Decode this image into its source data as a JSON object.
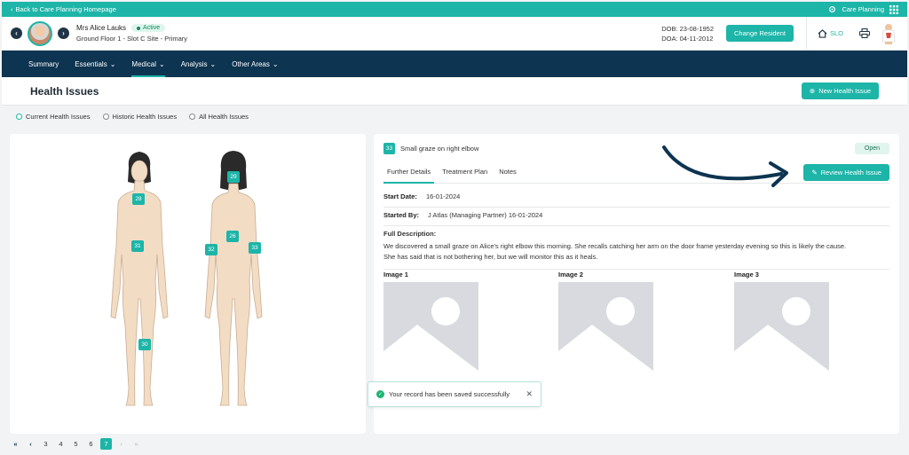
{
  "topbar": {
    "back_label": "Back to Care Planning Homepage",
    "app_label": "Care Planning"
  },
  "resident": {
    "name": "Mrs Alice Lauks",
    "status": "Active",
    "location": "Ground Floor 1 - Slot C Site - Primary",
    "dob": "DOB: 23-08-1952",
    "doa": "DOA: 04-11-2012",
    "change_label": "Change Resident",
    "slo_label": "SLO"
  },
  "nav": {
    "items": [
      {
        "label": "Summary"
      },
      {
        "label": "Essentials"
      },
      {
        "label": "Medical"
      },
      {
        "label": "Analysis"
      },
      {
        "label": "Other Areas"
      }
    ]
  },
  "page": {
    "title": "Health Issues",
    "new_label": "New Health Issue"
  },
  "filters": {
    "current": "Current Health Issues",
    "historic": "Historic Health Issues",
    "all": "All Health Issues"
  },
  "body_map": {
    "markers": [
      "28",
      "31",
      "30",
      "29",
      "26",
      "32",
      "33"
    ]
  },
  "issue": {
    "number": "33",
    "title": "Small graze on right elbow",
    "status": "Open",
    "tabs": [
      "Further Details",
      "Treatment Plan",
      "Notes"
    ],
    "review_label": "Review Health Issue",
    "start_date_label": "Start Date:",
    "start_date": "16-01-2024",
    "started_by_label": "Started By:",
    "started_by": "J Atlas (Managing Partner) 16-01-2024",
    "desc_label": "Full Description:",
    "desc_line1": "We discovered a small graze on Alice's right elbow this morning. She recalls catching her arm on the door frame yesterday evening so this is likely the cause.",
    "desc_line2": "She has said that is not bothering her, but we will monitor this as it heals.",
    "images": [
      "Image 1",
      "Image 2",
      "Image 3"
    ]
  },
  "toast": {
    "message": "Your record has been saved successfully"
  },
  "pager": {
    "pages": [
      "3",
      "4",
      "5",
      "6",
      "7"
    ],
    "current": "7"
  },
  "colors": {
    "accent": "#1db5a8",
    "nav": "#0d3450",
    "arrow": "#0d3450"
  }
}
